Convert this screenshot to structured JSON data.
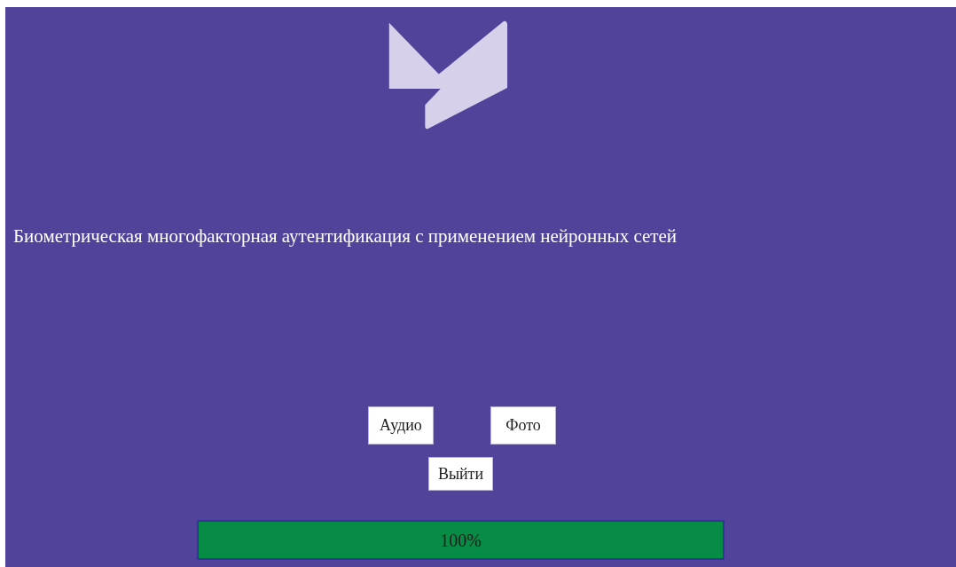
{
  "title": "Биометрическая многофакторная аутентификация с применением нейронных сетей",
  "buttons": [
    {
      "label": "Аудио"
    },
    {
      "label": "Фото"
    }
  ],
  "exit_button": {
    "label": "Выйти"
  },
  "progress": {
    "level": 1,
    "reading": "100%"
  }
}
